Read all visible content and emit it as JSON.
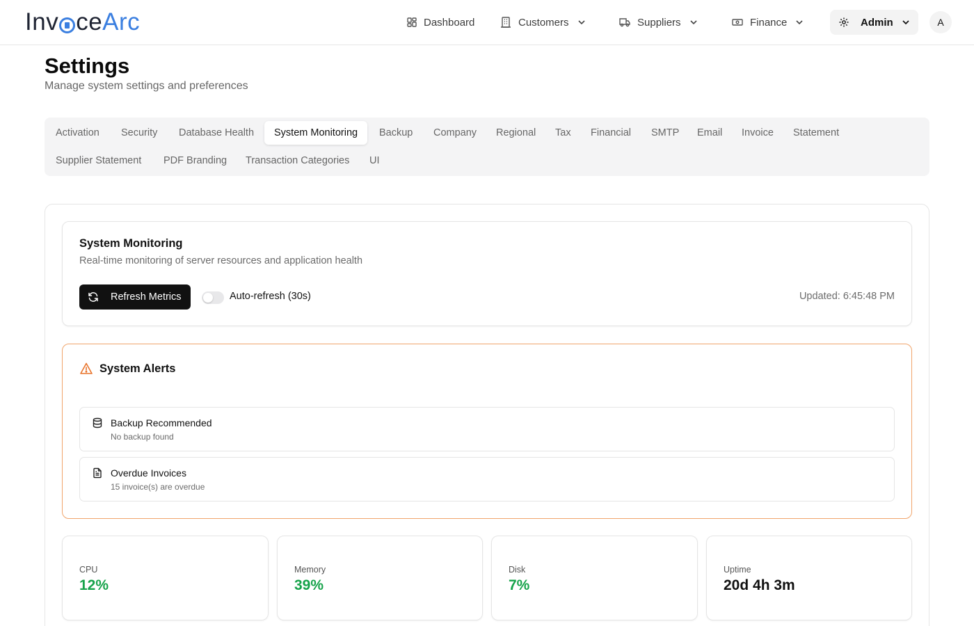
{
  "brand": {
    "part1": "Inv",
    "part2": "ice",
    "part3": "Arc"
  },
  "nav": {
    "dashboard": "Dashboard",
    "customers": "Customers",
    "suppliers": "Suppliers",
    "finance": "Finance",
    "admin": "Admin",
    "avatar_initial": "A"
  },
  "header": {
    "title": "Settings",
    "subtitle": "Manage system settings and preferences"
  },
  "tabs": [
    "Activation",
    "Security",
    "Database Health",
    "System Monitoring",
    "Backup",
    "Company",
    "Regional",
    "Tax",
    "Financial",
    "SMTP",
    "Email",
    "Invoice",
    "Statement",
    "Supplier Statement",
    "PDF Branding",
    "Transaction Categories",
    "UI"
  ],
  "active_tab": "System Monitoring",
  "monitoring": {
    "title": "System Monitoring",
    "description": "Real-time monitoring of server resources and application health",
    "refresh_label": "Refresh Metrics",
    "auto_refresh_label": "Auto-refresh (30s)",
    "auto_refresh_enabled": false,
    "updated": "Updated: 6:45:48 PM"
  },
  "alerts": {
    "title": "System Alerts",
    "items": [
      {
        "icon": "database-icon",
        "title": "Backup Recommended",
        "description": "No backup found"
      },
      {
        "icon": "file-text-icon",
        "title": "Overdue Invoices",
        "description": "15 invoice(s) are overdue"
      }
    ]
  },
  "metrics": [
    {
      "label": "CPU",
      "value": "12%"
    },
    {
      "label": "Memory",
      "value": "39%"
    },
    {
      "label": "Disk",
      "value": "7%"
    },
    {
      "label": "Uptime",
      "value": "20d 4h 3m"
    }
  ],
  "colors": {
    "accent_blue": "#3b7fe0",
    "alert_orange": "#f0a46a",
    "healthy_green": "#16a34a",
    "primary_button": "#111111"
  }
}
